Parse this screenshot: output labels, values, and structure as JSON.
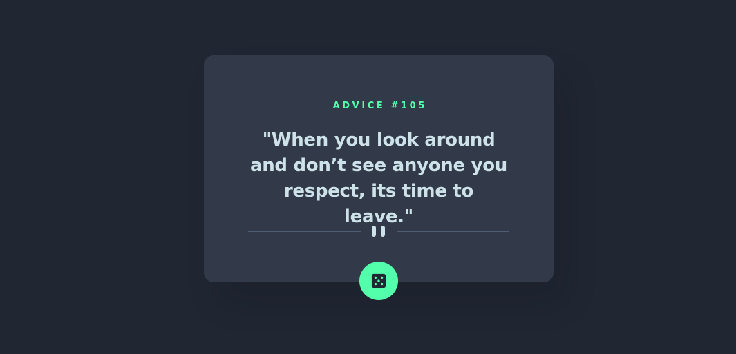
{
  "advice": {
    "label": "ADVICE #105",
    "quote": "\"When you look around and don’t see anyone you respect, its time to leave.\""
  },
  "icons": {
    "divider": "pause-icon",
    "button": "dice-icon"
  },
  "colors": {
    "background": "#202632",
    "card": "#323A49",
    "accent": "#53FFAA",
    "text": "#CEE3E9",
    "divider": "#4F5D74"
  }
}
